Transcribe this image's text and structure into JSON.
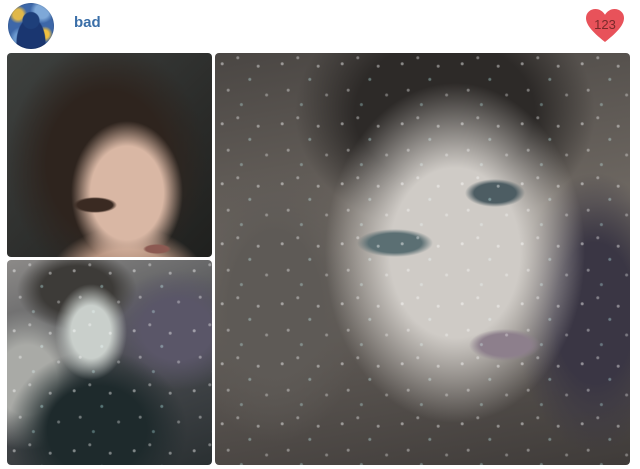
{
  "post": {
    "username": "bad",
    "like_count": "123",
    "colors": {
      "username": "#3b6fa8",
      "like_heart": "#e8525a"
    },
    "icons": {
      "avatar": "user-avatar",
      "like": "heart-icon"
    }
  }
}
